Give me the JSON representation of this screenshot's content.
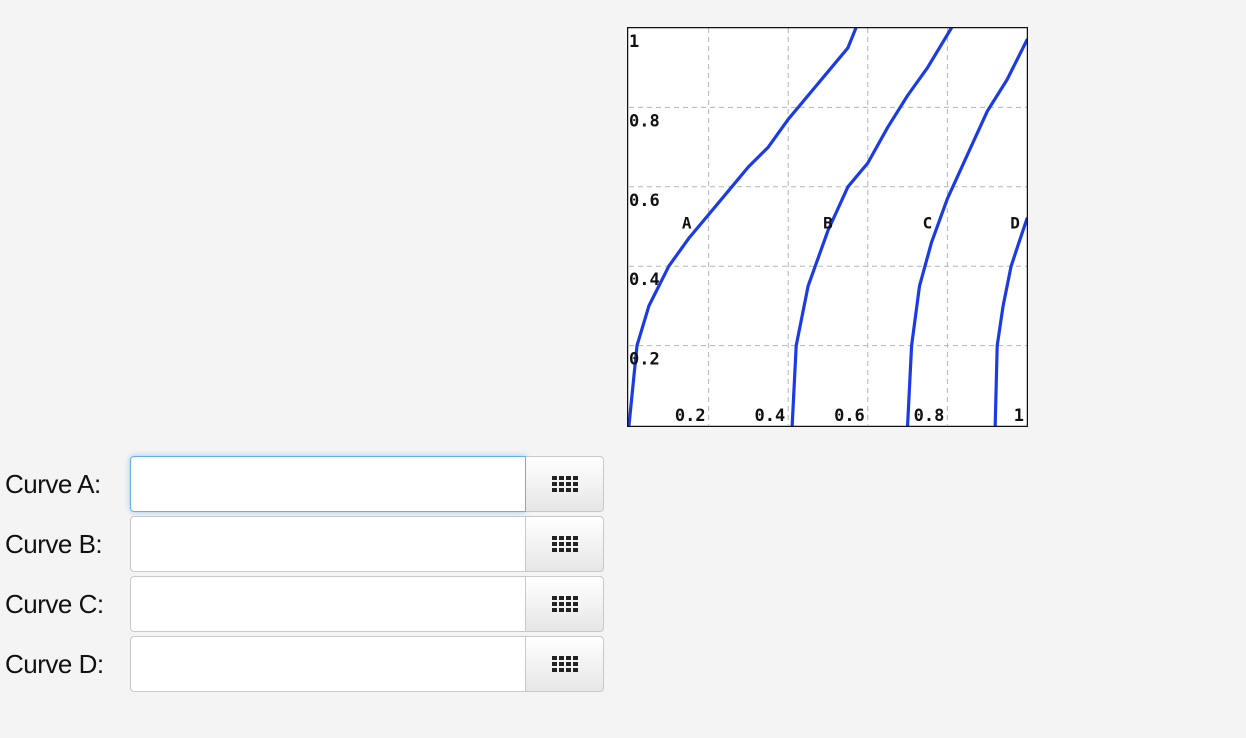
{
  "chart_data": {
    "type": "line",
    "xlim": [
      0,
      1
    ],
    "ylim": [
      0,
      1
    ],
    "xticks": [
      "0.2",
      "0.4",
      "0.6",
      "0.8",
      "1"
    ],
    "yticks": [
      "0.2",
      "0.4",
      "0.6",
      "0.8",
      "1"
    ],
    "grid": true,
    "line_color": "#1a3be6",
    "series": [
      {
        "name": "A",
        "x": [
          0.0,
          0.02,
          0.05,
          0.1,
          0.15,
          0.2,
          0.25,
          0.3,
          0.35,
          0.4,
          0.45,
          0.5,
          0.55,
          0.57
        ],
        "y": [
          0.0,
          0.2,
          0.3,
          0.4,
          0.47,
          0.53,
          0.59,
          0.65,
          0.7,
          0.77,
          0.83,
          0.89,
          0.95,
          1.0
        ]
      },
      {
        "name": "B",
        "x": [
          0.41,
          0.42,
          0.45,
          0.5,
          0.55,
          0.6,
          0.65,
          0.7,
          0.75,
          0.78,
          0.81
        ],
        "y": [
          0.0,
          0.2,
          0.35,
          0.49,
          0.6,
          0.66,
          0.75,
          0.83,
          0.9,
          0.95,
          1.0
        ]
      },
      {
        "name": "C",
        "x": [
          0.7,
          0.71,
          0.73,
          0.76,
          0.8,
          0.85,
          0.9,
          0.95,
          1.0
        ],
        "y": [
          0.0,
          0.2,
          0.35,
          0.46,
          0.57,
          0.68,
          0.79,
          0.87,
          0.97
        ]
      },
      {
        "name": "D",
        "x": [
          0.92,
          0.925,
          0.94,
          0.96,
          0.98,
          1.0
        ],
        "y": [
          0.0,
          0.2,
          0.3,
          0.4,
          0.46,
          0.52
        ]
      }
    ],
    "curve_labels": [
      {
        "text": "A",
        "x": 0.145,
        "y": 0.51
      },
      {
        "text": "B",
        "x": 0.5,
        "y": 0.51
      },
      {
        "text": "C",
        "x": 0.75,
        "y": 0.51
      },
      {
        "text": "D",
        "x": 0.97,
        "y": 0.51
      }
    ]
  },
  "form": {
    "rows": [
      {
        "label": "Curve A:",
        "value": "",
        "focused": true
      },
      {
        "label": "Curve B:",
        "value": ""
      },
      {
        "label": "Curve C:",
        "value": ""
      },
      {
        "label": "Curve D:",
        "value": ""
      }
    ],
    "keyboard_icon": "keypad-icon"
  }
}
